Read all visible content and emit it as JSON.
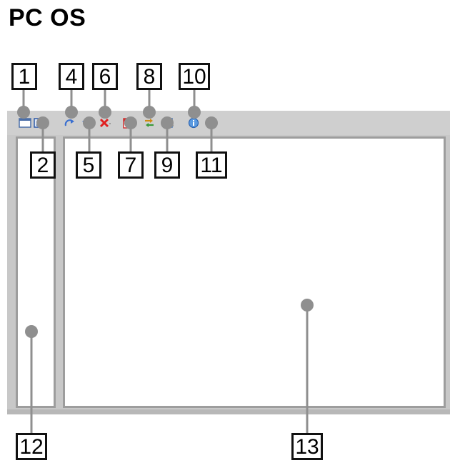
{
  "title": "PC OS",
  "callouts": [
    {
      "id": "1",
      "label": "1"
    },
    {
      "id": "2",
      "label": "2"
    },
    {
      "id": "4",
      "label": "4"
    },
    {
      "id": "5",
      "label": "5"
    },
    {
      "id": "6",
      "label": "6"
    },
    {
      "id": "7",
      "label": "7"
    },
    {
      "id": "8",
      "label": "8"
    },
    {
      "id": "9",
      "label": "9"
    },
    {
      "id": "10",
      "label": "10"
    },
    {
      "id": "11",
      "label": "11"
    },
    {
      "id": "12",
      "label": "12"
    },
    {
      "id": "13",
      "label": "13"
    }
  ],
  "toolbar_icons": [
    "window-icon",
    "window-icon-2",
    "redo-icon",
    "undo-icon",
    "delete-icon",
    "calendar-icon",
    "transfer-icon",
    "user-icon",
    "info-icon",
    "exit-icon"
  ],
  "colors": {
    "frame": "#c8c8c8",
    "pane_border": "#9d9d9d",
    "callout_dot": "#8f8f8f"
  }
}
